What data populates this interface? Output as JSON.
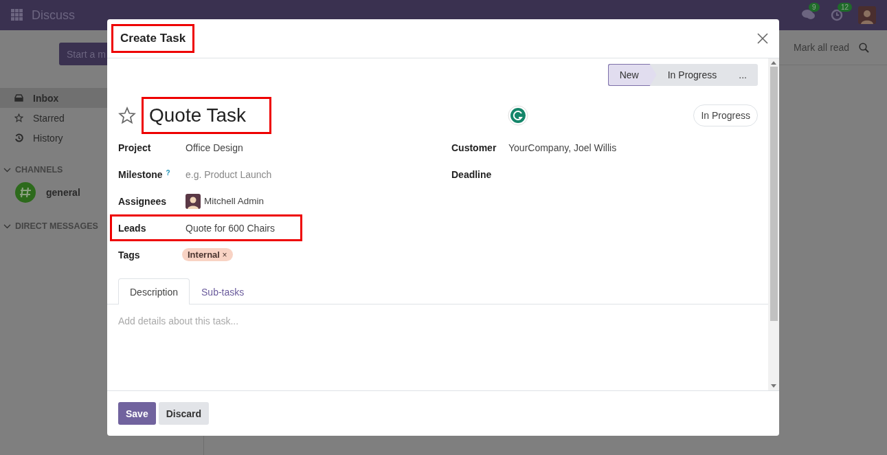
{
  "navbar": {
    "app_title": "Discuss",
    "messages_badge": "9",
    "activities_badge": "12"
  },
  "sidebar": {
    "start_button": "Start a m",
    "items": [
      {
        "label": "Inbox",
        "selected": true
      },
      {
        "label": "Starred",
        "selected": false
      },
      {
        "label": "History",
        "selected": false
      }
    ],
    "sections": [
      {
        "title": "CHANNELS",
        "expanded": true,
        "channels": [
          {
            "name": "general"
          }
        ]
      },
      {
        "title": "DIRECT MESSAGES",
        "expanded": true
      }
    ]
  },
  "toolbar": {
    "mark_all_read": "Mark all read"
  },
  "modal": {
    "title": "Create Task",
    "title_highlighted": true,
    "stages": [
      {
        "label": "New",
        "selected": true
      },
      {
        "label": "In Progress",
        "selected": false
      },
      {
        "label": "...",
        "selected": false
      }
    ],
    "starred": false,
    "task_name": "Quote Task",
    "task_name_highlighted": true,
    "status": "In Progress",
    "left_fields": [
      {
        "label": "Project",
        "kind": "text",
        "value": "Office Design",
        "highlighted": false
      },
      {
        "label": "Milestone",
        "help": "?",
        "kind": "placeholder",
        "placeholder": "e.g. Product Launch",
        "highlighted": false
      },
      {
        "label": "Assignees",
        "kind": "user",
        "value": "Mitchell Admin",
        "highlighted": false
      },
      {
        "label": "Leads",
        "kind": "text",
        "value": "Quote for 600 Chairs",
        "highlighted": true
      },
      {
        "label": "Tags",
        "kind": "tag",
        "value": "Internal",
        "remove": "×",
        "highlighted": false
      }
    ],
    "right_fields": [
      {
        "label": "Customer",
        "kind": "text",
        "value": "YourCompany, Joel Willis",
        "highlighted": false
      },
      {
        "label": "Deadline",
        "kind": "empty",
        "highlighted": false
      }
    ],
    "tabs": [
      {
        "label": "Description",
        "selected": true
      },
      {
        "label": "Sub-tasks",
        "selected": false
      }
    ],
    "description_placeholder": "Add details about this task...",
    "buttons": [
      {
        "label": "Save",
        "kind": "primary"
      },
      {
        "label": "Discard",
        "kind": "secondary"
      }
    ]
  }
}
